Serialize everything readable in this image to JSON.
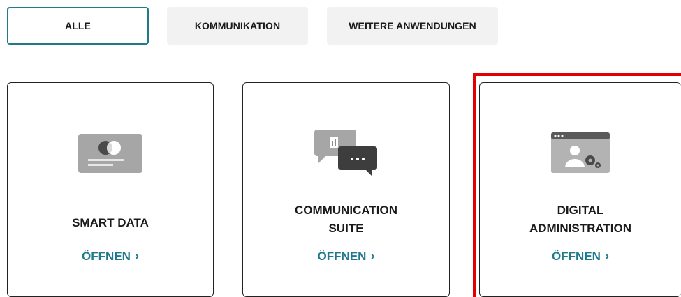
{
  "filters": [
    {
      "label": "ALLE",
      "active": true
    },
    {
      "label": "KOMMUNIKATION",
      "active": false
    },
    {
      "label": "WEITERE ANWENDUNGEN",
      "active": false
    }
  ],
  "cards": [
    {
      "title_lines": [
        "SMART DATA"
      ],
      "open_label": "ÖFFNEN",
      "icon": "id-card-icon"
    },
    {
      "title_lines": [
        "COMMUNICATION",
        "SUITE"
      ],
      "open_label": "ÖFFNEN",
      "icon": "chat-bubbles-icon"
    },
    {
      "title_lines": [
        "DIGITAL",
        "ADMINISTRATION"
      ],
      "open_label": "ÖFFNEN",
      "icon": "user-settings-icon"
    }
  ],
  "colors": {
    "accent": "#1f7a8c",
    "highlight": "#e30000",
    "icon_gray": "#8c8c8c"
  }
}
